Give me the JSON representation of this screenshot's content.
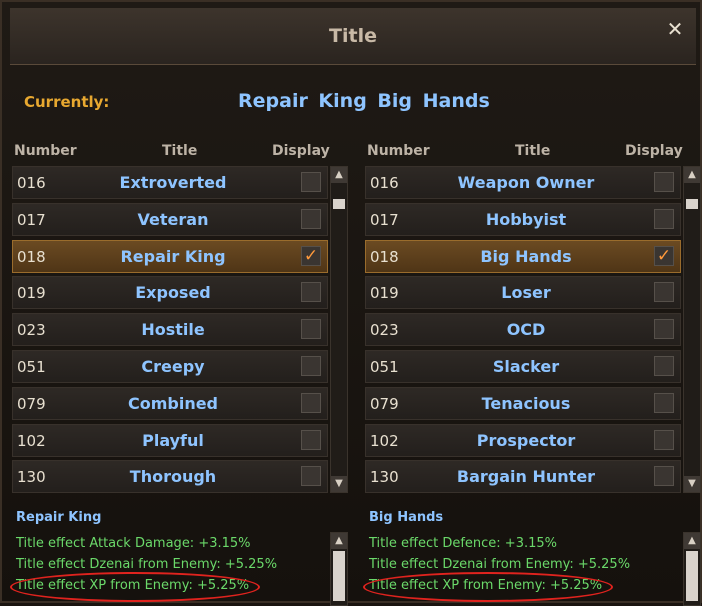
{
  "window": {
    "title": "Title",
    "close_icon": "close-icon"
  },
  "current": {
    "label": "Currently:",
    "value": "Repair King  Big Hands"
  },
  "columns": {
    "number": "Number",
    "title": "Title",
    "display": "Display"
  },
  "left_list": [
    {
      "num": "016",
      "name": "Extroverted",
      "checked": false
    },
    {
      "num": "017",
      "name": "Veteran",
      "checked": false
    },
    {
      "num": "018",
      "name": "Repair King",
      "checked": true
    },
    {
      "num": "019",
      "name": "Exposed",
      "checked": false
    },
    {
      "num": "023",
      "name": "Hostile",
      "checked": false
    },
    {
      "num": "051",
      "name": "Creepy",
      "checked": false
    },
    {
      "num": "079",
      "name": "Combined",
      "checked": false
    },
    {
      "num": "102",
      "name": "Playful",
      "checked": false
    },
    {
      "num": "130",
      "name": "Thorough",
      "checked": false
    }
  ],
  "right_list": [
    {
      "num": "016",
      "name": "Weapon Owner",
      "checked": false
    },
    {
      "num": "017",
      "name": "Hobbyist",
      "checked": false
    },
    {
      "num": "018",
      "name": "Big Hands",
      "checked": true
    },
    {
      "num": "019",
      "name": "Loser",
      "checked": false
    },
    {
      "num": "023",
      "name": "OCD",
      "checked": false
    },
    {
      "num": "051",
      "name": "Slacker",
      "checked": false
    },
    {
      "num": "079",
      "name": "Tenacious",
      "checked": false
    },
    {
      "num": "102",
      "name": "Prospector",
      "checked": false
    },
    {
      "num": "130",
      "name": "Bargain Hunter",
      "checked": false
    }
  ],
  "effects_left": {
    "title": "Repair King",
    "lines": [
      "Title effect Attack Damage: +3.15%",
      "Title effect Dzenai from Enemy: +5.25%",
      "Title effect XP from Enemy: +5.25%"
    ]
  },
  "effects_right": {
    "title": "Big Hands",
    "lines": [
      "Title effect Defence: +3.15%",
      "Title effect Dzenai from Enemy: +5.25%",
      "Title effect XP from Enemy: +5.25%"
    ]
  },
  "colors": {
    "accent": "#e8a830",
    "title_blue": "#8ec4ff",
    "effect_green": "#6bd96a",
    "selected_row": "#6b4a22",
    "highlight_circle": "#e0231e"
  }
}
